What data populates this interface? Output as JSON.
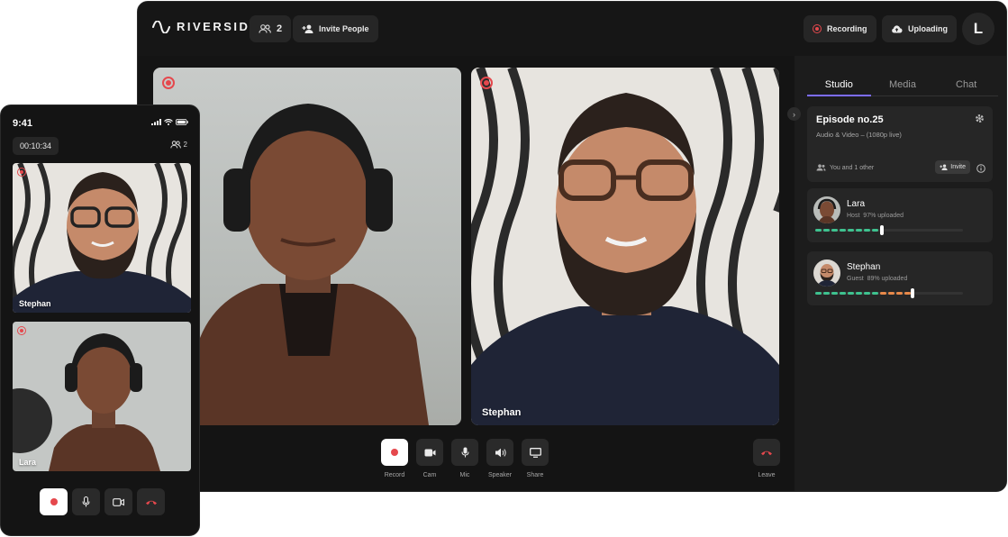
{
  "desktop": {
    "brand": "RIVERSIDE",
    "participants_count": "2",
    "invite_label": "Invite People",
    "recording_label": "Recording",
    "uploading_label": "Uploading",
    "user_initial": "L",
    "tiles": [
      {
        "name": ""
      },
      {
        "name": "Stephan"
      }
    ],
    "controls": [
      {
        "label": "Record",
        "icon": "record-icon"
      },
      {
        "label": "Cam",
        "icon": "camera-icon"
      },
      {
        "label": "Mic",
        "icon": "microphone-icon"
      },
      {
        "label": "Speaker",
        "icon": "speaker-icon"
      },
      {
        "label": "Share",
        "icon": "screen-share-icon"
      }
    ],
    "leave_label": "Leave",
    "sidebar": {
      "tabs": [
        "Studio",
        "Media",
        "Chat"
      ],
      "active_tab": "Studio",
      "episode": {
        "title": "Episode no.25",
        "subtitle": "Audio & Video – (1080p live)",
        "who": "You and 1 other",
        "invite": "Invite"
      },
      "participants": [
        {
          "name": "Lara",
          "role": "Host",
          "uploaded": "97% uploaded",
          "progress": 0.45
        },
        {
          "name": "Stephan",
          "role": "Guest",
          "uploaded": "89% uploaded",
          "progress": 0.66
        }
      ]
    },
    "colors": {
      "accent": "#7c6cff",
      "record": "#e5484d",
      "upload_done": "#3ec28f",
      "upload_pending": "#e8894a"
    }
  },
  "phone": {
    "time": "9:41",
    "timer": "00:10:34",
    "participants_count": "2",
    "tiles": [
      {
        "name": "Stephan"
      },
      {
        "name": "Lara"
      }
    ]
  }
}
